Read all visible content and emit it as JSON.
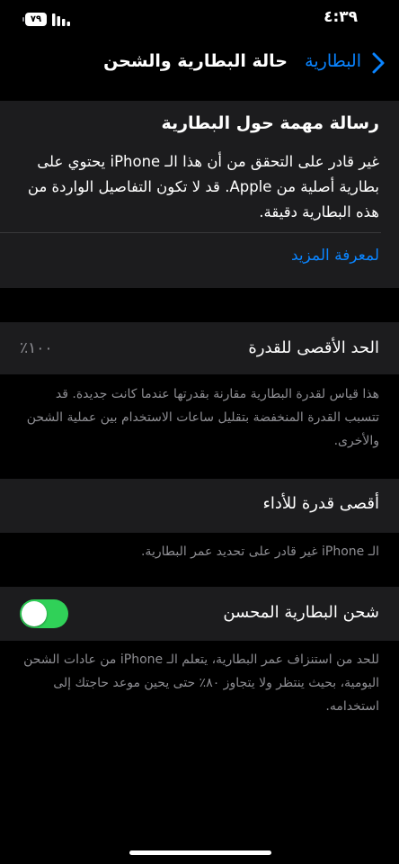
{
  "status_bar": {
    "time": "٤:٣٩",
    "battery_level": "٧٩",
    "icons": [
      "battery-icon",
      "signal-icon"
    ]
  },
  "nav": {
    "back_label": "البطارية",
    "title": "حالة البطارية والشحن",
    "accent_color": "#0a84ff"
  },
  "alert": {
    "title": "رسالة مهمة حول البطارية",
    "body": "غير قادر على التحقق من أن هذا الـ iPhone يحتوي على بطارية أصلية من Apple. قد لا تكون التفاصيل الواردة من هذه البطارية دقيقة.",
    "learn_more": "لمعرفة المزيد"
  },
  "maximum_capacity": {
    "label": "الحد الأقصى للقدرة",
    "value": "١٠٠٪",
    "footnote": "هذا قياس لقدرة البطارية مقارنة بقدرتها عندما كانت جديدة. قد تتسبب القدرة المنخفضة بتقليل ساعات الاستخدام بين عملية الشحن والأخرى."
  },
  "peak_performance": {
    "label": "أقصى قدرة للأداء",
    "footnote": "الـ iPhone غير قادر على تحديد عمر البطارية."
  },
  "optimized_charging": {
    "label": "شحن البطارية المحسن",
    "enabled": true,
    "toggle_color": "#30d158",
    "footnote": "للحد من استنزاف عمر البطارية، يتعلم الـ iPhone من عادات الشحن اليومية، بحيث ينتظر ولا يتجاوز ٨٠٪ حتى يحين موعد حاجتك إلى استخدامه."
  }
}
